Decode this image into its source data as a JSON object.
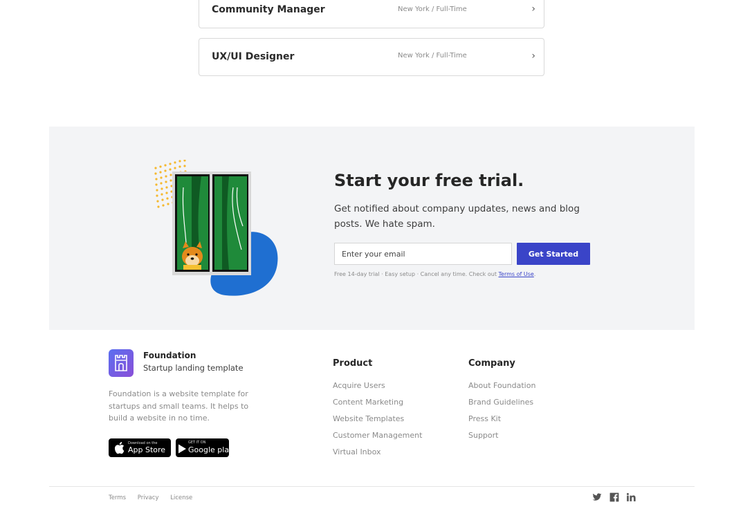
{
  "jobs": [
    {
      "title": "Community Manager",
      "meta": "New York / Full-Time"
    },
    {
      "title": "UX/UI Designer",
      "meta": "New York / Full-Time"
    }
  ],
  "cta": {
    "heading": "Start your free trial.",
    "description": "Get notified about company updates, news and blog posts. We hate spam.",
    "email_placeholder": "Enter your email",
    "button_label": "Get Started",
    "fine_print": "Free 14-day trial · Easy setup · Cancel any time. Check out ",
    "terms_link": "Terms of Use",
    "fine_print_end": ".",
    "accent_color": "#3a44c8"
  },
  "footer": {
    "brand_name": "Foundation",
    "brand_tagline": "Startup landing template",
    "brand_description": "Foundation is a website template for startups and small teams. It helps to build a website in no time.",
    "app_store": {
      "small": "Download on the",
      "big": "App Store"
    },
    "google_play": {
      "small": "GET IT ON",
      "big": "Google play"
    },
    "product": {
      "heading": "Product",
      "links": [
        "Acquire Users",
        "Content Marketing",
        "Website Templates",
        "Customer Management",
        "Virtual Inbox"
      ]
    },
    "company": {
      "heading": "Company",
      "links": [
        "About Foundation",
        "Brand Guidelines",
        "Press Kit",
        "Support"
      ]
    },
    "legal": [
      "Terms",
      "Privacy",
      "License"
    ],
    "social_icons": [
      "twitter-icon",
      "facebook-icon",
      "linkedin-icon"
    ]
  }
}
